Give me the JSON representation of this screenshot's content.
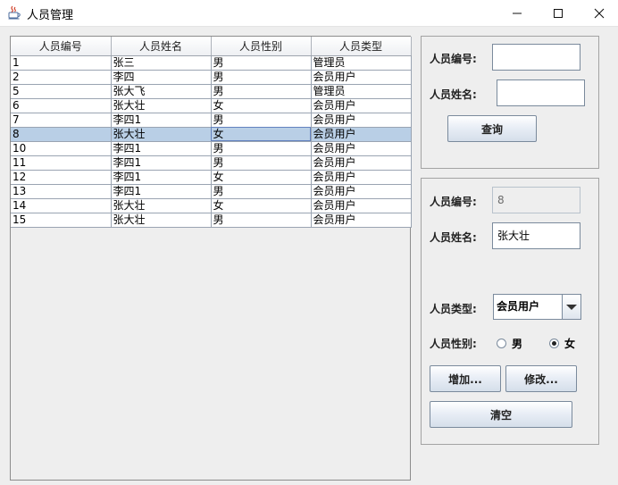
{
  "window": {
    "title": "人员管理",
    "minimize": "—",
    "maximize": "☐",
    "close": "✕"
  },
  "table": {
    "columns": [
      "人员编号",
      "人员姓名",
      "人员性别",
      "人员类型"
    ],
    "rows": [
      [
        "1",
        "张三",
        "男",
        "管理员"
      ],
      [
        "2",
        "李四",
        "男",
        "会员用户"
      ],
      [
        "5",
        "张大飞",
        "男",
        "管理员"
      ],
      [
        "6",
        "张大壮",
        "女",
        "会员用户"
      ],
      [
        "7",
        "李四1",
        "男",
        "会员用户"
      ],
      [
        "8",
        "张大壮",
        "女",
        "会员用户"
      ],
      [
        "10",
        "李四1",
        "男",
        "会员用户"
      ],
      [
        "11",
        "李四1",
        "男",
        "会员用户"
      ],
      [
        "12",
        "李四1",
        "女",
        "会员用户"
      ],
      [
        "13",
        "李四1",
        "男",
        "会员用户"
      ],
      [
        "14",
        "张大壮",
        "女",
        "会员用户"
      ],
      [
        "15",
        "张大壮",
        "男",
        "会员用户"
      ]
    ],
    "selected_index": 5
  },
  "query": {
    "id_label": "人员编号:",
    "id_value": "",
    "name_label": "人员姓名:",
    "name_value": "",
    "search_button": "查询"
  },
  "edit": {
    "id_label": "人员编号:",
    "id_value": "8",
    "name_label": "人员姓名:",
    "name_value": "张大壮",
    "type_label": "人员类型:",
    "type_value": "会员用户",
    "gender_label": "人员性别:",
    "male": "男",
    "female": "女",
    "gender_selected": "女",
    "add_button": "增加...",
    "modify_button": "修改...",
    "clear_button": "清空"
  }
}
